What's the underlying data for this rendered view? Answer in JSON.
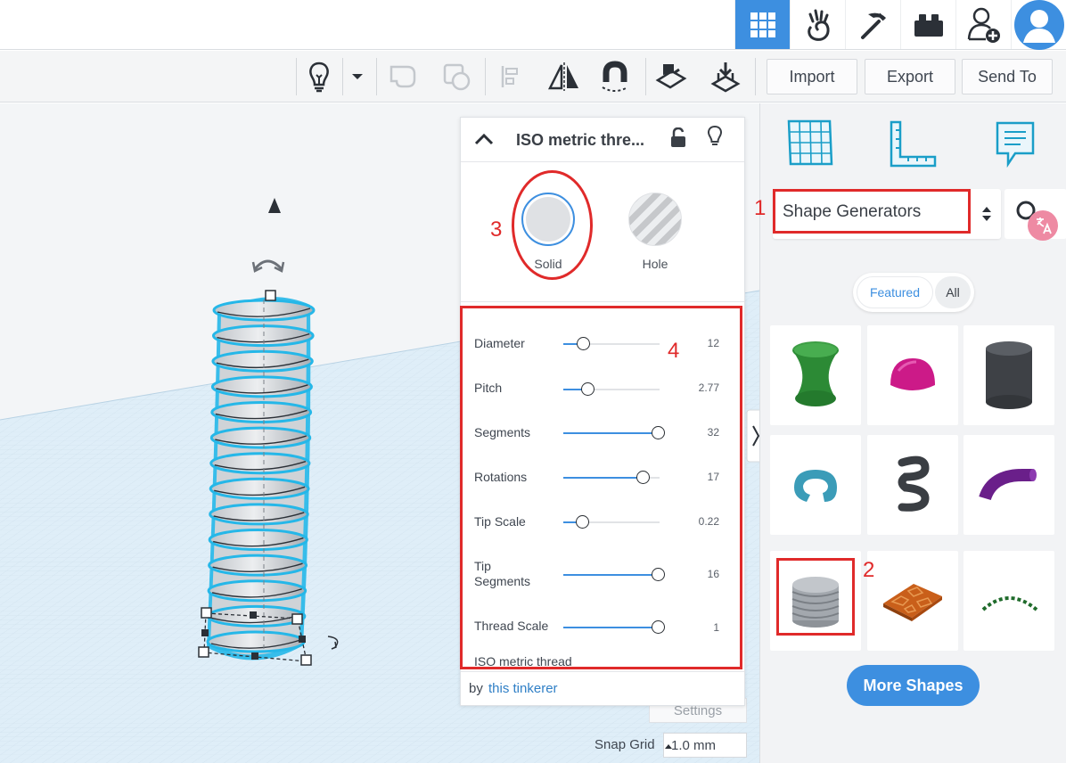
{
  "topbar": {
    "nav": [
      {
        "icon": "grid-view-icon",
        "active": true
      },
      {
        "icon": "hand-gesture-icon",
        "active": false
      },
      {
        "icon": "pickaxe-icon",
        "active": false
      },
      {
        "icon": "brick-icon",
        "active": false
      },
      {
        "icon": "add-user-icon",
        "active": false
      },
      {
        "icon": "avatar-icon",
        "active": false
      }
    ]
  },
  "toolbar": {
    "icons": [
      "lightbulb-icon",
      "dropdown-caret-icon",
      "group-icon",
      "ungroup-icon",
      "align-icon",
      "mirror-icon",
      "magnet-icon",
      "workplane-icon",
      "drop-to-workplane-icon"
    ],
    "import_label": "Import",
    "export_label": "Export",
    "sendto_label": "Send To"
  },
  "inspector": {
    "title": "ISO metric thre...",
    "solid_label": "Solid",
    "hole_label": "Hole",
    "params": [
      {
        "label": "Diameter",
        "value": "12",
        "level": 0.2
      },
      {
        "label": "Pitch",
        "value": "2.77",
        "level": 0.25
      },
      {
        "label": "Segments",
        "value": "32",
        "level": 0.98
      },
      {
        "label": "Rotations",
        "value": "17",
        "level": 0.82
      },
      {
        "label": "Tip Scale",
        "value": "0.22",
        "level": 0.19
      },
      {
        "label": "Tip\nSegments",
        "value": "16",
        "level": 0.98
      },
      {
        "label": "Thread Scale",
        "value": "1",
        "level": 0.98
      }
    ],
    "shape_name": "ISO metric thread",
    "by_text": "by ",
    "author_link": "this tinkerer"
  },
  "workplane": {
    "settings_label": "Settings",
    "snap_label": "Snap Grid",
    "snap_value": "1.0 mm"
  },
  "rightpanel": {
    "category": "Shape Generators",
    "tabs": [
      {
        "label": "Featured",
        "active": true
      },
      {
        "label": "All",
        "active": false
      }
    ],
    "shapes": [
      "hyperboloid-shape",
      "half-sphere-shape",
      "cylinder-shape",
      "torus-shape",
      "spring-shape",
      "bent-tube-shape",
      "iso-thread-shape",
      "voronoi-tile-shape",
      "text-arc-shape"
    ],
    "more_label": "More Shapes"
  },
  "annotations": [
    "1",
    "2",
    "3",
    "4"
  ],
  "colors": {
    "accent": "#3d8fe0",
    "annotation": "#e02a2a",
    "selection": "#25b7e8"
  }
}
